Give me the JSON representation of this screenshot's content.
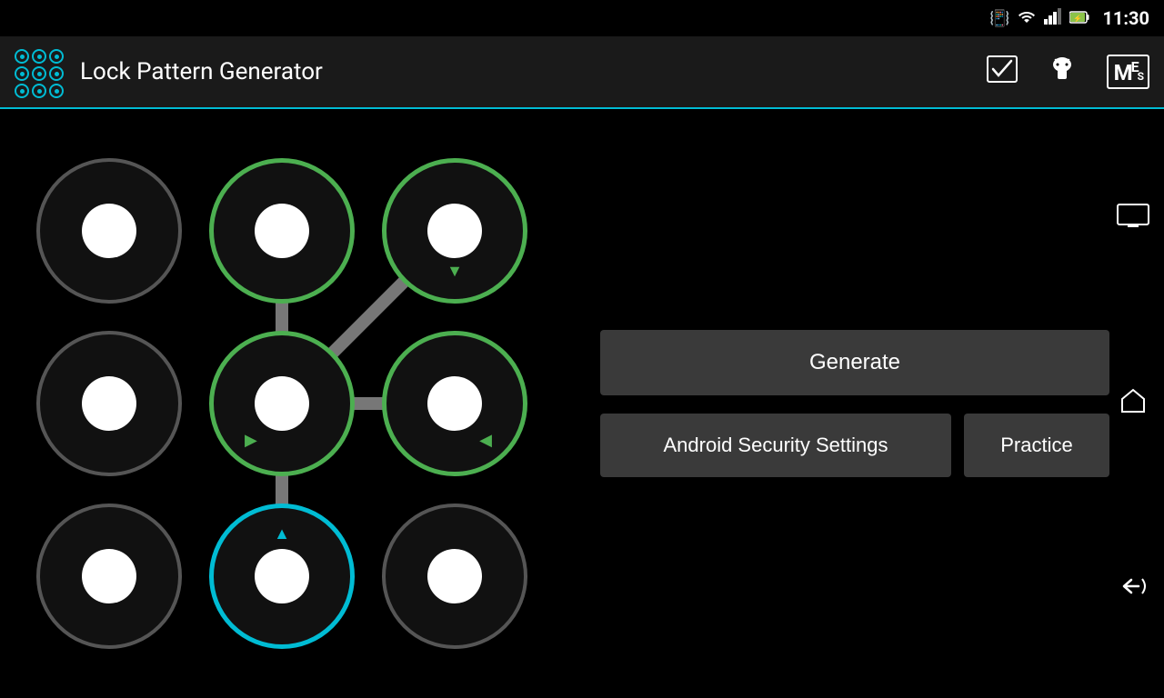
{
  "statusBar": {
    "time": "11:30",
    "icons": [
      "vibrate",
      "wifi",
      "signal",
      "battery"
    ]
  },
  "appBar": {
    "title": "Lock Pattern Generator",
    "toolbarIcons": [
      "checkmark",
      "android-help",
      "menu-ms"
    ]
  },
  "patternGrid": {
    "nodes": [
      {
        "id": 0,
        "row": 0,
        "col": 0,
        "state": "inactive",
        "arrow": null
      },
      {
        "id": 1,
        "row": 0,
        "col": 1,
        "state": "active-green",
        "arrow": null
      },
      {
        "id": 2,
        "row": 0,
        "col": 2,
        "state": "active-green",
        "arrow": "down"
      },
      {
        "id": 3,
        "row": 1,
        "col": 0,
        "state": "inactive",
        "arrow": null
      },
      {
        "id": 4,
        "row": 1,
        "col": 1,
        "state": "active-green",
        "arrow": "right-down"
      },
      {
        "id": 5,
        "row": 1,
        "col": 2,
        "state": "active-green",
        "arrow": "left-down"
      },
      {
        "id": 6,
        "row": 2,
        "col": 0,
        "state": "inactive",
        "arrow": null
      },
      {
        "id": 7,
        "row": 2,
        "col": 1,
        "state": "active-cyan",
        "arrow": "up"
      },
      {
        "id": 8,
        "row": 2,
        "col": 2,
        "state": "inactive",
        "arrow": null
      }
    ]
  },
  "buttons": {
    "generate": "Generate",
    "androidSecurity": "Android Security Settings",
    "practice": "Practice"
  },
  "navIcons": {
    "top": "screen-icon",
    "middle": "home-icon",
    "bottom": "back-icon"
  }
}
